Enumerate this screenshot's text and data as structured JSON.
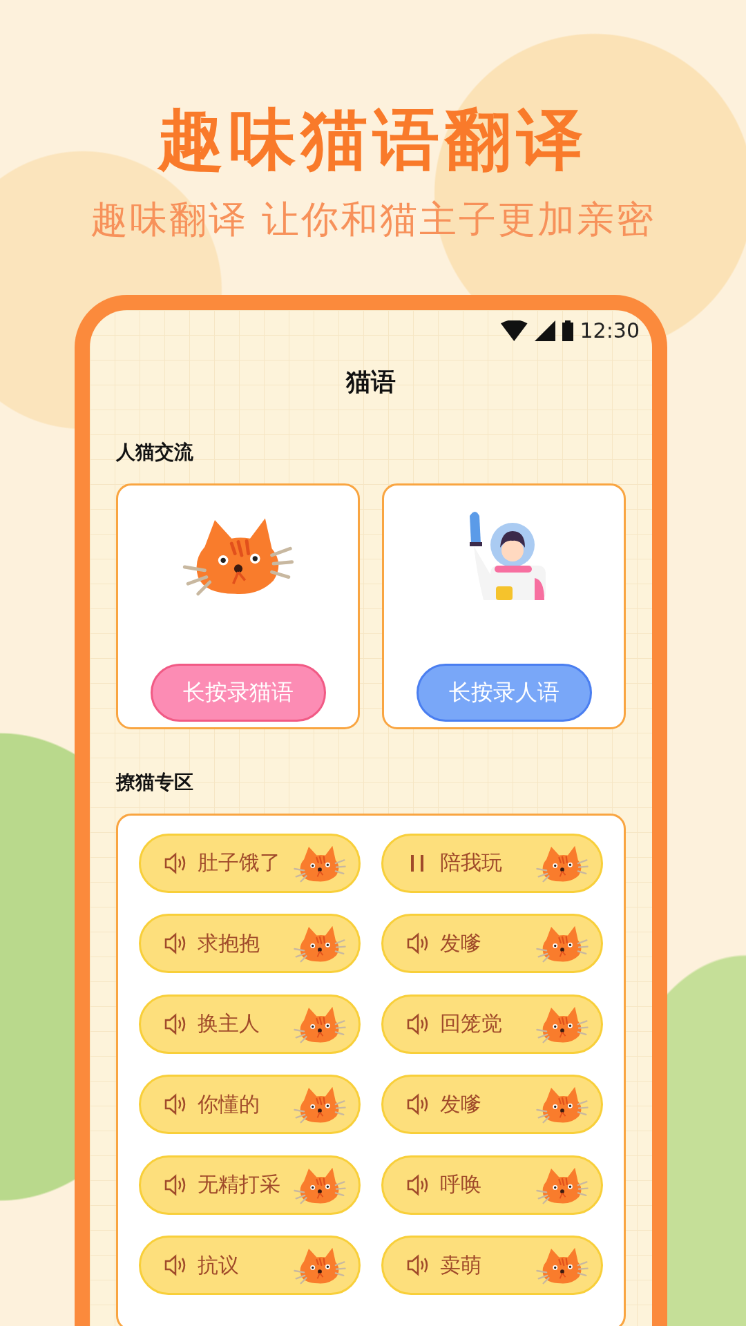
{
  "promo": {
    "title": "趣味猫语翻译",
    "subtitle": "趣味翻译 让你和猫主子更加亲密"
  },
  "status_bar": {
    "time": "12:30"
  },
  "screen": {
    "title": "猫语"
  },
  "chat_section": {
    "heading": "人猫交流",
    "cards": [
      {
        "kind": "cat",
        "button": "长按录猫语"
      },
      {
        "kind": "human",
        "button": "长按录人语"
      }
    ]
  },
  "tease_section": {
    "heading": "撩猫专区",
    "sounds": [
      {
        "label": "肚子饿了",
        "playing": false
      },
      {
        "label": "陪我玩",
        "playing": true
      },
      {
        "label": "求抱抱",
        "playing": false
      },
      {
        "label": "发嗲",
        "playing": false
      },
      {
        "label": "换主人",
        "playing": false
      },
      {
        "label": "回笼觉",
        "playing": false
      },
      {
        "label": "你懂的",
        "playing": false
      },
      {
        "label": "发嗲",
        "playing": false
      },
      {
        "label": "无精打采",
        "playing": false
      },
      {
        "label": "呼唤",
        "playing": false
      },
      {
        "label": "抗议",
        "playing": false
      },
      {
        "label": "卖萌",
        "playing": false
      }
    ]
  }
}
